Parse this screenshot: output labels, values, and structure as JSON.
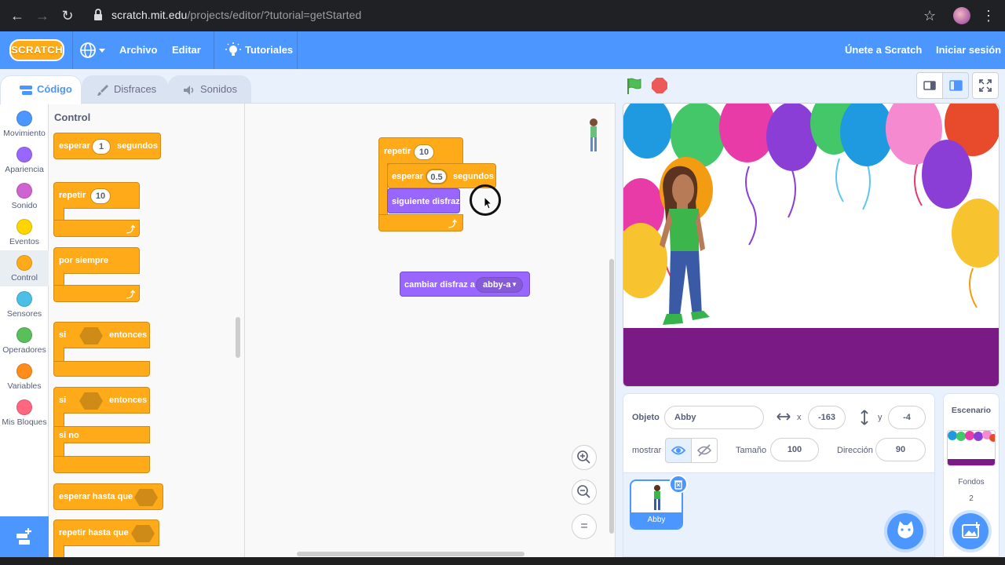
{
  "browser": {
    "url_host": "scratch.mit.edu",
    "url_path": "/projects/editor/?tutorial=getStarted"
  },
  "menubar": {
    "logo": "SCRATCH",
    "items": [
      "Archivo",
      "Editar"
    ],
    "tutorials": "Tutoriales",
    "join": "Únete a Scratch",
    "signin": "Iniciar sesión"
  },
  "tabs": [
    {
      "label": "Código",
      "active": true
    },
    {
      "label": "Disfraces",
      "active": false
    },
    {
      "label": "Sonidos",
      "active": false
    }
  ],
  "categories": [
    {
      "label": "Movimiento",
      "color": "#4c97ff"
    },
    {
      "label": "Apariencia",
      "color": "#9966ff"
    },
    {
      "label": "Sonido",
      "color": "#cf63cf"
    },
    {
      "label": "Eventos",
      "color": "#ffd500"
    },
    {
      "label": "Control",
      "color": "#ffab19",
      "selected": true
    },
    {
      "label": "Sensores",
      "color": "#4cbfe6"
    },
    {
      "label": "Operadores",
      "color": "#59c059"
    },
    {
      "label": "Variables",
      "color": "#ff8c1a"
    },
    {
      "label": "Mis Bloques",
      "color": "#ff6680"
    }
  ],
  "palette": {
    "title": "Control",
    "wait": {
      "label": "esperar",
      "value": "1",
      "suffix": "segundos"
    },
    "repeat": {
      "label": "repetir",
      "value": "10"
    },
    "forever": {
      "label": "por siempre"
    },
    "if": {
      "label": "si",
      "then": "entonces"
    },
    "ifelse": {
      "label": "si",
      "then": "entonces",
      "else": "si no"
    },
    "wait_until": {
      "label": "esperar hasta que"
    },
    "repeat_until": {
      "label": "repetir hasta que"
    }
  },
  "workspace": {
    "repeat": {
      "label": "repetir",
      "value": "10"
    },
    "wait": {
      "label": "esperar",
      "value": "0.5",
      "suffix": "segundos"
    },
    "next_costume": {
      "label": "siguiente disfraz"
    },
    "switch_costume": {
      "label": "cambiar disfraz a",
      "value": "abby-a"
    },
    "zoom_reset": "="
  },
  "sprite_info": {
    "object_label": "Objeto",
    "object_name": "Abby",
    "x_label": "x",
    "x_value": "-163",
    "y_label": "y",
    "y_value": "-4",
    "show_label": "mostrar",
    "size_label": "Tamaño",
    "size_value": "100",
    "direction_label": "Dirección",
    "direction_value": "90"
  },
  "sprites": [
    {
      "name": "Abby",
      "selected": true
    }
  ],
  "stage_panel": {
    "title": "Escenario",
    "backdrops_label": "Fondos",
    "backdrops_count": "2"
  },
  "colors": {
    "scratch_blue": "#4c97ff",
    "control": "#ffab19",
    "looks": "#9966ff",
    "stage_floor": "#7a1a85"
  }
}
